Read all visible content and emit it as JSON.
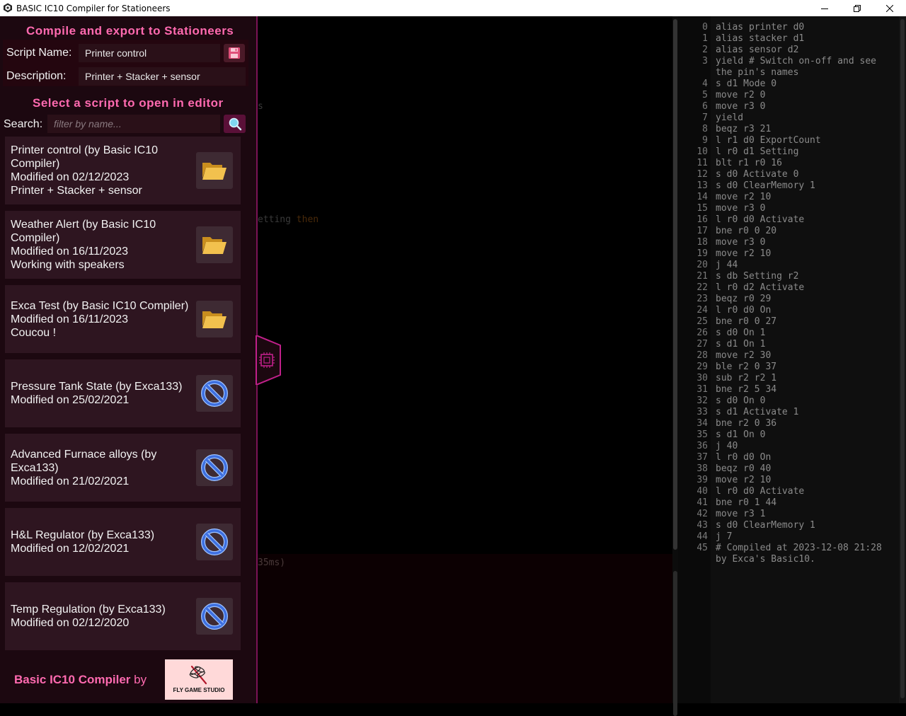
{
  "window": {
    "title": "BASIC IC10 Compiler for Stationeers"
  },
  "drawer": {
    "compile_title": "Compile and export to Stationeers",
    "script_name_label": "Script Name:",
    "script_name_value": "Printer control",
    "description_label": "Description:",
    "description_value": "Printer + Stacker + sensor",
    "select_title": "Select a script to open in editor",
    "search_label": "Search:",
    "search_placeholder": "filter by name...",
    "scripts": [
      {
        "lines": [
          "Printer control (by Basic IC10",
          "Compiler)",
          "Modified on 02/12/2023",
          "Printer + Stacker + sensor"
        ],
        "action": "open-folder-icon"
      },
      {
        "lines": [
          "Weather Alert (by Basic IC10",
          "Compiler)",
          "Modified on 16/11/2023",
          "Working with speakers"
        ],
        "action": "open-folder-icon"
      },
      {
        "lines": [
          "Exca Test (by Basic IC10 Compiler)",
          "Modified on 16/11/2023",
          "Coucou !"
        ],
        "action": "open-folder-icon"
      },
      {
        "lines": [
          "Pressure Tank State (by Exca133)",
          "Modified on 25/02/2021"
        ],
        "action": "blocked-icon"
      },
      {
        "lines": [
          "Advanced Furnace alloys (by",
          "Exca133)",
          "Modified on 21/02/2021"
        ],
        "action": "blocked-icon"
      },
      {
        "lines": [
          "H&L Regulator (by Exca133)",
          "Modified on 12/02/2021"
        ],
        "action": "blocked-icon"
      },
      {
        "lines": [
          "Temp Regulation (by Exca133)",
          "Modified on 02/12/2020"
        ],
        "action": "blocked-icon"
      }
    ],
    "footer_brand": "Basic IC10 Compiler",
    "footer_by": "by",
    "logo_text": "FLY GAME STUDIO"
  },
  "editor_ghost": {
    "line1": "s",
    "line2_a": "etting",
    "line2_b": "then",
    "line3": "35ms)"
  },
  "compiled_code": [
    {
      "n": "0",
      "t": "alias printer d0"
    },
    {
      "n": "1",
      "t": "alias stacker d1"
    },
    {
      "n": "2",
      "t": "alias sensor d2"
    },
    {
      "n": "3",
      "t": "yield # Switch on-off and see the pin's names"
    },
    {
      "n": "4",
      "t": "s d1 Mode 0"
    },
    {
      "n": "5",
      "t": "move r2 0"
    },
    {
      "n": "6",
      "t": "move r3 0"
    },
    {
      "n": "7",
      "t": "yield"
    },
    {
      "n": "8",
      "t": "beqz r3 21"
    },
    {
      "n": "9",
      "t": "l r1 d0 ExportCount"
    },
    {
      "n": "10",
      "t": "l r0 d1 Setting"
    },
    {
      "n": "11",
      "t": "blt r1 r0 16"
    },
    {
      "n": "12",
      "t": "s d0 Activate 0"
    },
    {
      "n": "13",
      "t": "s d0 ClearMemory 1"
    },
    {
      "n": "14",
      "t": "move r2 10"
    },
    {
      "n": "15",
      "t": "move r3 0"
    },
    {
      "n": "16",
      "t": "l r0 d0 Activate"
    },
    {
      "n": "17",
      "t": "bne r0 0 20"
    },
    {
      "n": "18",
      "t": "move r3 0"
    },
    {
      "n": "19",
      "t": "move r2 10"
    },
    {
      "n": "20",
      "t": "j 44"
    },
    {
      "n": "21",
      "t": "s db Setting r2"
    },
    {
      "n": "22",
      "t": "l r0 d2 Activate"
    },
    {
      "n": "23",
      "t": "beqz r0 29"
    },
    {
      "n": "24",
      "t": "l r0 d0 On"
    },
    {
      "n": "25",
      "t": "bne r0 0 27"
    },
    {
      "n": "26",
      "t": "s d0 On 1"
    },
    {
      "n": "27",
      "t": "s d1 On 1"
    },
    {
      "n": "28",
      "t": "move r2 30"
    },
    {
      "n": "29",
      "t": "ble r2 0 37"
    },
    {
      "n": "30",
      "t": "sub r2 r2 1"
    },
    {
      "n": "31",
      "t": "bne r2 5 34"
    },
    {
      "n": "32",
      "t": "s d0 On 0"
    },
    {
      "n": "33",
      "t": "s d1 Activate 1"
    },
    {
      "n": "34",
      "t": "bne r2 0 36"
    },
    {
      "n": "35",
      "t": "s d1 On 0"
    },
    {
      "n": "36",
      "t": "j 40"
    },
    {
      "n": "37",
      "t": "l r0 d0 On"
    },
    {
      "n": "38",
      "t": "beqz r0 40"
    },
    {
      "n": "39",
      "t": "move r2 10"
    },
    {
      "n": "40",
      "t": "l r0 d0 Activate"
    },
    {
      "n": "41",
      "t": "bne r0 1 44"
    },
    {
      "n": "42",
      "t": "move r3 1"
    },
    {
      "n": "43",
      "t": "s d0 ClearMemory 1"
    },
    {
      "n": "44",
      "t": "j 7"
    },
    {
      "n": "45",
      "t": "# Compiled at 2023-12-08 21:28 by Exca's Basic10."
    }
  ],
  "colors": {
    "accent": "#ff6ab0",
    "drawer_bg": "#1c0810",
    "card_bg": "#2e1520",
    "folder": "#f2c14e",
    "blocked": "#5b8ef0"
  }
}
